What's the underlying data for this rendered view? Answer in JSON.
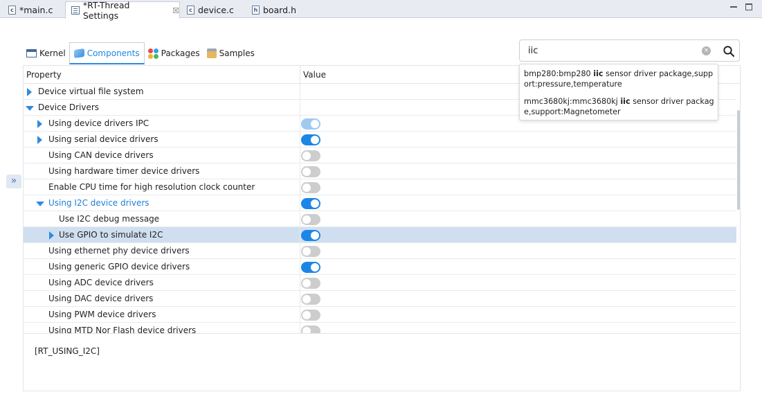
{
  "editor_tabs": [
    {
      "label": "*main.c",
      "icon": "c-file-icon",
      "icon_glyph": "c"
    },
    {
      "label": "*RT-Thread Settings",
      "icon": "settings-file-icon",
      "icon_glyph": "",
      "close": "☒"
    },
    {
      "label": "device.c",
      "icon": "c-file-icon",
      "icon_glyph": "c"
    },
    {
      "label": "board.h",
      "icon": "h-file-icon",
      "icon_glyph": "h"
    }
  ],
  "category_tabs": [
    {
      "label": "Kernel",
      "icon": "kernel-icon"
    },
    {
      "label": "Components",
      "icon": "components-icon",
      "active": true
    },
    {
      "label": "Packages",
      "icon": "packages-icon"
    },
    {
      "label": "Samples",
      "icon": "samples-icon"
    }
  ],
  "search": {
    "value": "iic",
    "clear_glyph": "×"
  },
  "suggestions": [
    {
      "before": "bmp280:bmp280 ",
      "match": "iic",
      "after": " sensor driver package,support:pressure,temperature"
    },
    {
      "before": "mmc3680kj:mmc3680kj ",
      "match": "iic",
      "after": " sensor driver package,support:Magnetometer"
    }
  ],
  "table": {
    "headers": {
      "property": "Property",
      "value": "Value"
    },
    "rows": [
      {
        "label": "Device virtual file system",
        "indent": 0,
        "expander": "collapsed",
        "toggle": "none"
      },
      {
        "label": "Device Drivers",
        "indent": 0,
        "expander": "expanded",
        "toggle": "none"
      },
      {
        "label": "Using device drivers IPC",
        "indent": 1,
        "expander": "collapsed",
        "toggle": "dim"
      },
      {
        "label": "Using serial device drivers",
        "indent": 1,
        "expander": "collapsed",
        "toggle": "on"
      },
      {
        "label": "Using CAN device drivers",
        "indent": 1,
        "expander": "none",
        "toggle": "off"
      },
      {
        "label": "Using hardware timer device drivers",
        "indent": 1,
        "expander": "none",
        "toggle": "off"
      },
      {
        "label": "Enable CPU time for high resolution clock counter",
        "indent": 1,
        "expander": "none",
        "toggle": "off"
      },
      {
        "label": "Using I2C device drivers",
        "indent": 1,
        "expander": "expanded",
        "toggle": "on",
        "highlight": true
      },
      {
        "label": "Use I2C debug message",
        "indent": 2,
        "expander": "none",
        "toggle": "off"
      },
      {
        "label": "Use GPIO to simulate I2C",
        "indent": 2,
        "expander": "collapsed",
        "toggle": "on",
        "selected": true
      },
      {
        "label": "Using ethernet phy device drivers",
        "indent": 1,
        "expander": "none",
        "toggle": "off"
      },
      {
        "label": "Using generic GPIO device drivers",
        "indent": 1,
        "expander": "none",
        "toggle": "on"
      },
      {
        "label": "Using ADC device drivers",
        "indent": 1,
        "expander": "none",
        "toggle": "off"
      },
      {
        "label": "Using DAC device drivers",
        "indent": 1,
        "expander": "none",
        "toggle": "off"
      },
      {
        "label": "Using PWM device drivers",
        "indent": 1,
        "expander": "none",
        "toggle": "off"
      },
      {
        "label": "Using MTD Nor Flash device drivers",
        "indent": 1,
        "expander": "none",
        "toggle": "off"
      }
    ]
  },
  "description": "[RT_USING_I2C]",
  "side_handle_glyph": "»",
  "colors": {
    "accent": "#1c86e6",
    "selected_row": "#cfdff0",
    "toggle_off": "#cdcdcd"
  }
}
